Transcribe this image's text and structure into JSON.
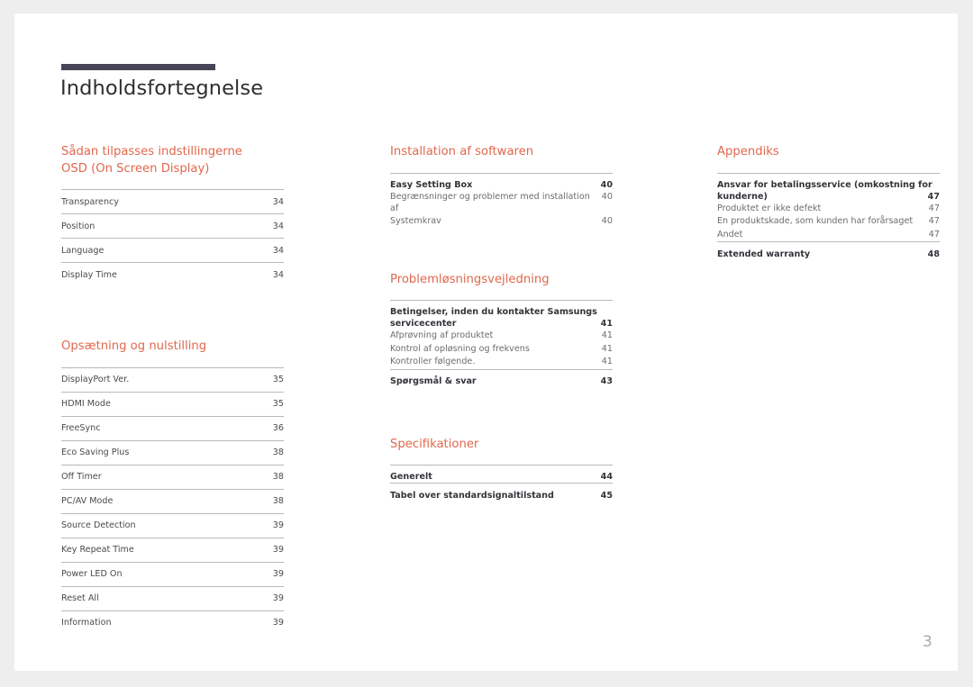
{
  "document": {
    "title": "Indholdsfortegnelse",
    "page_number": "3",
    "accent_color": "#e0684d",
    "rule_color": "#484458"
  },
  "columns": [
    {
      "id": "column-1",
      "sections": [
        {
          "heading": "Sådan tilpasses indstillingerne\nOSD (On Screen Display)",
          "entries": [
            {
              "label": "Transparency",
              "page": "34",
              "style": "ruled"
            },
            {
              "label": "Position",
              "page": "34",
              "style": "ruled"
            },
            {
              "label": "Language",
              "page": "34",
              "style": "ruled"
            },
            {
              "label": "Display Time",
              "page": "34",
              "style": "ruled"
            }
          ]
        },
        {
          "heading": "Opsætning og nulstilling",
          "entries": [
            {
              "label": "DisplayPort Ver.",
              "page": "35",
              "style": "ruled"
            },
            {
              "label": "HDMI Mode",
              "page": "35",
              "style": "ruled"
            },
            {
              "label": "FreeSync",
              "page": "36",
              "style": "ruled"
            },
            {
              "label": "Eco Saving Plus",
              "page": "38",
              "style": "ruled"
            },
            {
              "label": "Off Timer",
              "page": "38",
              "style": "ruled"
            },
            {
              "label": "PC/AV Mode",
              "page": "38",
              "style": "ruled"
            },
            {
              "label": "Source Detection",
              "page": "39",
              "style": "ruled"
            },
            {
              "label": "Key Repeat Time",
              "page": "39",
              "style": "ruled"
            },
            {
              "label": "Power LED On",
              "page": "39",
              "style": "ruled"
            },
            {
              "label": "Reset All",
              "page": "39",
              "style": "ruled"
            },
            {
              "label": "Information",
              "page": "39",
              "style": "ruled"
            }
          ]
        }
      ]
    },
    {
      "id": "column-2",
      "sections": [
        {
          "heading": "Installation af softwaren",
          "entries": [
            {
              "label": "Easy Setting Box",
              "page": "40",
              "style": "head"
            },
            {
              "label": "Begrænsninger og problemer med installation af",
              "page": "40",
              "style": "sub"
            },
            {
              "label": "Systemkrav",
              "page": "40",
              "style": "sub"
            }
          ]
        },
        {
          "heading": "Problemløsningsvejledning",
          "entries": [
            {
              "label": "Betingelser, inden du kontakter Samsungs",
              "label2": "servicecenter",
              "page": "41",
              "style": "head-multiline"
            },
            {
              "label": "Afprøvning af produktet",
              "page": "41",
              "style": "sub"
            },
            {
              "label": "Kontrol af opløsning og frekvens",
              "page": "41",
              "style": "sub"
            },
            {
              "label": "Kontroller følgende.",
              "page": "41",
              "style": "sub"
            },
            {
              "label": "Spørgsmål & svar",
              "page": "43",
              "style": "head-ruled"
            }
          ]
        },
        {
          "heading": "Specifikationer",
          "entries": [
            {
              "label": "Generelt",
              "page": "44",
              "style": "head"
            },
            {
              "label": "Tabel over standardsignaltilstand",
              "page": "45",
              "style": "head-ruled"
            }
          ]
        }
      ]
    },
    {
      "id": "column-3",
      "sections": [
        {
          "heading": "Appendiks",
          "entries": [
            {
              "label": "Ansvar for betalingsservice (omkostning for",
              "label2": "kunderne)",
              "page": "47",
              "style": "head-multiline"
            },
            {
              "label": "Produktet er ikke defekt",
              "page": "47",
              "style": "sub"
            },
            {
              "label": "En produktskade, som kunden har forårsaget",
              "page": "47",
              "style": "sub"
            },
            {
              "label": "Andet",
              "page": "47",
              "style": "sub"
            },
            {
              "label": "Extended warranty",
              "page": "48",
              "style": "head-ruled"
            }
          ]
        }
      ]
    }
  ]
}
